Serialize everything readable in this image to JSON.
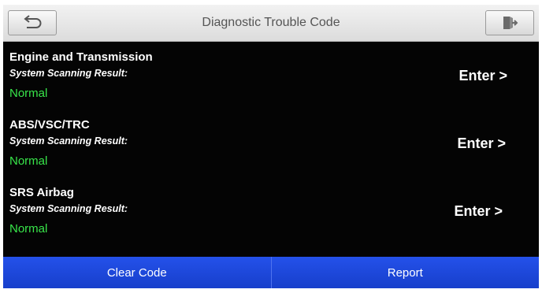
{
  "header": {
    "title": "Diagnostic Trouble Code",
    "back_icon": "back-arrow-icon",
    "exit_icon": "exit-door-icon"
  },
  "systems": [
    {
      "name": "Engine and Transmission",
      "scan_label": "System Scanning Result:",
      "result": "Normal",
      "action": "Enter >"
    },
    {
      "name": "ABS/VSC/TRC",
      "scan_label": "System Scanning Result:",
      "result": "Normal",
      "action": "Enter >"
    },
    {
      "name": "SRS Airbag",
      "scan_label": "System Scanning Result:",
      "result": "Normal",
      "action": "Enter >"
    }
  ],
  "footer": {
    "clear_label": "Clear Code",
    "report_label": "Report"
  },
  "colors": {
    "background": "#040404",
    "normal_status": "#38e64a",
    "footer_button": "#1b45d8"
  }
}
